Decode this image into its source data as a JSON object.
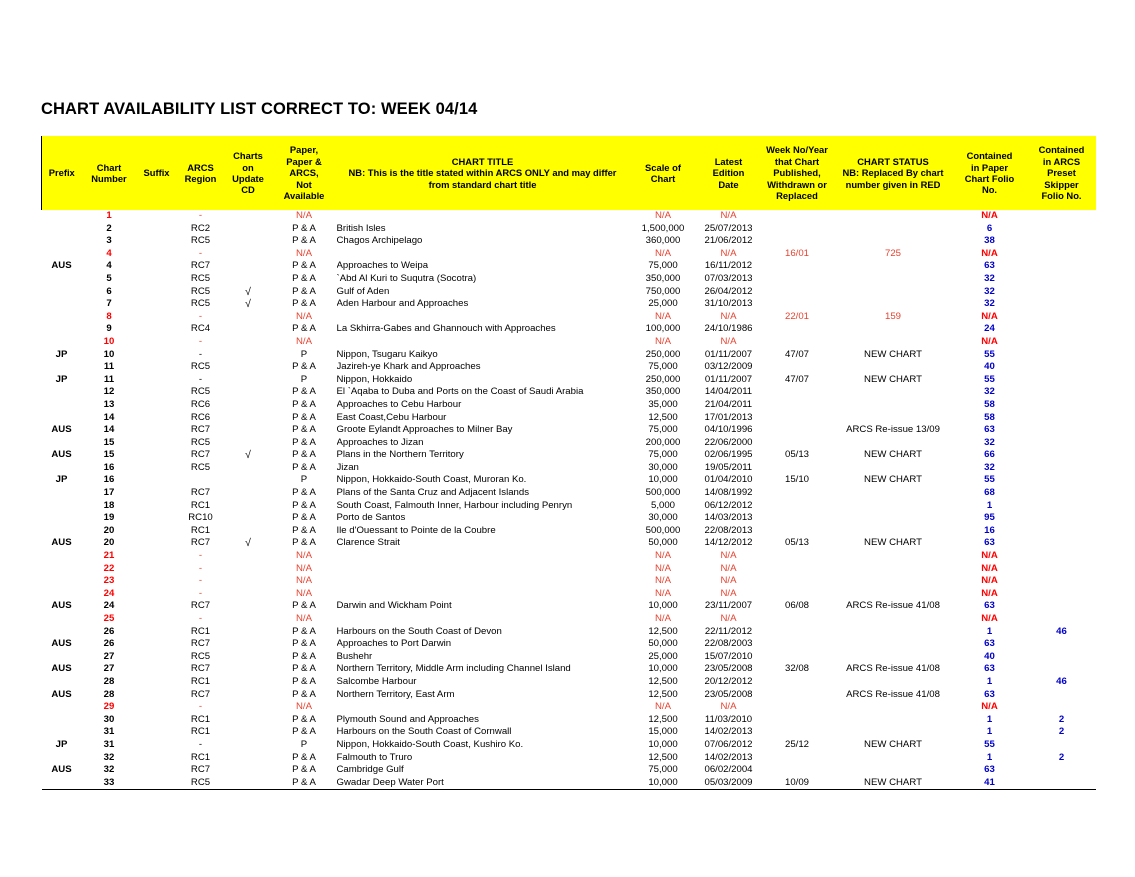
{
  "document": {
    "title": "CHART AVAILABILITY LIST CORRECT TO: WEEK 04/14"
  },
  "colors": {
    "header_background": "#ffff00",
    "folio_blue": "#0000cc",
    "unavailable_red": "#ff0000",
    "border": "#000000"
  },
  "table": {
    "columns": [
      {
        "key": "prefix",
        "label": "Prefix"
      },
      {
        "key": "number",
        "label": "Chart\nNumber"
      },
      {
        "key": "suffix",
        "label": "Suffix"
      },
      {
        "key": "region",
        "label": "ARCS\nRegion"
      },
      {
        "key": "cd",
        "label": "Charts\non\nUpdate\nCD"
      },
      {
        "key": "avail",
        "label": "Paper,\nPaper &\nARCS,\nNot\nAvailable"
      },
      {
        "key": "title",
        "label": "CHART TITLE\nNB: This is the title stated within ARCS ONLY and may differ\nfrom standard chart title"
      },
      {
        "key": "scale",
        "label": "Scale of\nChart"
      },
      {
        "key": "date",
        "label": "Latest\nEdition\nDate"
      },
      {
        "key": "week",
        "label": "Week No/Year\nthat Chart\nPublished,\nWithdrawn or\nReplaced"
      },
      {
        "key": "status",
        "label": "CHART STATUS\nNB: Replaced By chart\nnumber given in RED"
      },
      {
        "key": "folio",
        "label": "Contained\nin Paper\nChart Folio\nNo."
      },
      {
        "key": "skipper",
        "label": "Contained\nin ARCS\nPreset\nSkipper\nFolio No."
      }
    ],
    "header_labels": {
      "prefix": "Prefix",
      "number_l1": "Chart",
      "number_l2": "Number",
      "suffix": "Suffix",
      "region_l1": "ARCS",
      "region_l2": "Region",
      "cd_l1": "Charts",
      "cd_l2": "on",
      "cd_l3": "Update",
      "cd_l4": "CD",
      "avail_l1": "Paper,",
      "avail_l2": "Paper &",
      "avail_l3": "ARCS,",
      "avail_l4": "Not",
      "avail_l5": "Available",
      "title_l1": "CHART TITLE",
      "title_l2": "NB: This is the title stated within ARCS ONLY and may differ",
      "title_l3": "from standard chart title",
      "scale_l1": "Scale of",
      "scale_l2": "Chart",
      "date_l1": "Latest",
      "date_l2": "Edition",
      "date_l3": "Date",
      "week_l1": "Week No/Year",
      "week_l2": "that Chart",
      "week_l3": "Published,",
      "week_l4": "Withdrawn or",
      "week_l5": "Replaced",
      "status_l1": "CHART STATUS",
      "status_l2": "NB: Replaced By chart",
      "status_l3": "number given in RED",
      "folio_l1": "Contained",
      "folio_l2": "in Paper",
      "folio_l3": "Chart Folio",
      "folio_l4": "No.",
      "skipper_l1": "Contained",
      "skipper_l2": "in ARCS",
      "skipper_l3": "Preset",
      "skipper_l4": "Skipper",
      "skipper_l5": "Folio No."
    },
    "rows": [
      {
        "prefix": "",
        "number": "1",
        "suffix": "",
        "region": "-",
        "cd": "",
        "avail": "N/A",
        "title": "",
        "scale": "N/A",
        "date": "N/A",
        "week": "",
        "status": "",
        "folio": "N/A",
        "skipper": "",
        "unavailable": true
      },
      {
        "prefix": "",
        "number": "2",
        "suffix": "",
        "region": "RC2",
        "cd": "",
        "avail": "P & A",
        "title": "British Isles",
        "scale": "1,500,000",
        "date": "25/07/2013",
        "week": "",
        "status": "",
        "folio": "6",
        "skipper": "",
        "unavailable": false
      },
      {
        "prefix": "",
        "number": "3",
        "suffix": "",
        "region": "RC5",
        "cd": "",
        "avail": "P & A",
        "title": "Chagos Archipelago",
        "scale": "360,000",
        "date": "21/06/2012",
        "week": "",
        "status": "",
        "folio": "38",
        "skipper": "",
        "unavailable": false
      },
      {
        "prefix": "",
        "number": "4",
        "suffix": "",
        "region": "-",
        "cd": "",
        "avail": "N/A",
        "title": "",
        "scale": "N/A",
        "date": "N/A",
        "week": "16/01",
        "status": "725",
        "folio": "N/A",
        "skipper": "",
        "unavailable": true
      },
      {
        "prefix": "AUS",
        "number": "4",
        "suffix": "",
        "region": "RC7",
        "cd": "",
        "avail": "P & A",
        "title": "Approaches to Weipa",
        "scale": "75,000",
        "date": "16/11/2012",
        "week": "",
        "status": "",
        "folio": "63",
        "skipper": "",
        "unavailable": false
      },
      {
        "prefix": "",
        "number": "5",
        "suffix": "",
        "region": "RC5",
        "cd": "",
        "avail": "P & A",
        "title": "`Abd Al Kuri to Suqutra (Socotra)",
        "scale": "350,000",
        "date": "07/03/2013",
        "week": "",
        "status": "",
        "folio": "32",
        "skipper": "",
        "unavailable": false
      },
      {
        "prefix": "",
        "number": "6",
        "suffix": "",
        "region": "RC5",
        "cd": "√",
        "avail": "P & A",
        "title": "Gulf of Aden",
        "scale": "750,000",
        "date": "26/04/2012",
        "week": "",
        "status": "",
        "folio": "32",
        "skipper": "",
        "unavailable": false
      },
      {
        "prefix": "",
        "number": "7",
        "suffix": "",
        "region": "RC5",
        "cd": "√",
        "avail": "P & A",
        "title": "Aden Harbour and Approaches",
        "scale": "25,000",
        "date": "31/10/2013",
        "week": "",
        "status": "",
        "folio": "32",
        "skipper": "",
        "unavailable": false
      },
      {
        "prefix": "",
        "number": "8",
        "suffix": "",
        "region": "-",
        "cd": "",
        "avail": "N/A",
        "title": "",
        "scale": "N/A",
        "date": "N/A",
        "week": "22/01",
        "status": "159",
        "folio": "N/A",
        "skipper": "",
        "unavailable": true
      },
      {
        "prefix": "",
        "number": "9",
        "suffix": "",
        "region": "RC4",
        "cd": "",
        "avail": "P & A",
        "title": "La Skhirra-Gabes and Ghannouch with Approaches",
        "scale": "100,000",
        "date": "24/10/1986",
        "week": "",
        "status": "",
        "folio": "24",
        "skipper": "",
        "unavailable": false
      },
      {
        "prefix": "",
        "number": "10",
        "suffix": "",
        "region": "-",
        "cd": "",
        "avail": "N/A",
        "title": "",
        "scale": "N/A",
        "date": "N/A",
        "week": "",
        "status": "",
        "folio": "N/A",
        "skipper": "",
        "unavailable": true
      },
      {
        "prefix": "JP",
        "number": "10",
        "suffix": "",
        "region": "-",
        "cd": "",
        "avail": "P",
        "title": "Nippon, Tsugaru Kaikyo",
        "scale": "250,000",
        "date": "01/11/2007",
        "week": "47/07",
        "status": "NEW CHART",
        "folio": "55",
        "skipper": "",
        "unavailable": false
      },
      {
        "prefix": "",
        "number": "11",
        "suffix": "",
        "region": "RC5",
        "cd": "",
        "avail": "P & A",
        "title": "Jazireh-ye Khark and Approaches",
        "scale": "75,000",
        "date": "03/12/2009",
        "week": "",
        "status": "",
        "folio": "40",
        "skipper": "",
        "unavailable": false
      },
      {
        "prefix": "JP",
        "number": "11",
        "suffix": "",
        "region": "-",
        "cd": "",
        "avail": "P",
        "title": "Nippon, Hokkaido",
        "scale": "250,000",
        "date": "01/11/2007",
        "week": "47/07",
        "status": "NEW CHART",
        "folio": "55",
        "skipper": "",
        "unavailable": false
      },
      {
        "prefix": "",
        "number": "12",
        "suffix": "",
        "region": "RC5",
        "cd": "",
        "avail": "P & A",
        "title": "El `Aqaba to Duba and Ports on the Coast of Saudi Arabia",
        "scale": "350,000",
        "date": "14/04/2011",
        "week": "",
        "status": "",
        "folio": "32",
        "skipper": "",
        "unavailable": false
      },
      {
        "prefix": "",
        "number": "13",
        "suffix": "",
        "region": "RC6",
        "cd": "",
        "avail": "P & A",
        "title": "Approaches to Cebu Harbour",
        "scale": "35,000",
        "date": "21/04/2011",
        "week": "",
        "status": "",
        "folio": "58",
        "skipper": "",
        "unavailable": false
      },
      {
        "prefix": "",
        "number": "14",
        "suffix": "",
        "region": "RC6",
        "cd": "",
        "avail": "P & A",
        "title": "East Coast,Cebu Harbour",
        "scale": "12,500",
        "date": "17/01/2013",
        "week": "",
        "status": "",
        "folio": "58",
        "skipper": "",
        "unavailable": false
      },
      {
        "prefix": "AUS",
        "number": "14",
        "suffix": "",
        "region": "RC7",
        "cd": "",
        "avail": "P & A",
        "title": "Groote Eylandt  Approaches to Milner Bay",
        "scale": "75,000",
        "date": "04/10/1996",
        "week": "",
        "status": "ARCS Re-issue 13/09",
        "folio": "63",
        "skipper": "",
        "unavailable": false
      },
      {
        "prefix": "",
        "number": "15",
        "suffix": "",
        "region": "RC5",
        "cd": "",
        "avail": "P & A",
        "title": "Approaches to Jizan",
        "scale": "200,000",
        "date": "22/06/2000",
        "week": "",
        "status": "",
        "folio": "32",
        "skipper": "",
        "unavailable": false
      },
      {
        "prefix": "AUS",
        "number": "15",
        "suffix": "",
        "region": "RC7",
        "cd": "√",
        "avail": "P & A",
        "title": "Plans in the Northern Territory",
        "scale": "75,000",
        "date": "02/06/1995",
        "week": "05/13",
        "status": "NEW CHART",
        "folio": "66",
        "skipper": "",
        "unavailable": false
      },
      {
        "prefix": "",
        "number": "16",
        "suffix": "",
        "region": "RC5",
        "cd": "",
        "avail": "P & A",
        "title": "Jizan",
        "scale": "30,000",
        "date": "19/05/2011",
        "week": "",
        "status": "",
        "folio": "32",
        "skipper": "",
        "unavailable": false
      },
      {
        "prefix": "JP",
        "number": "16",
        "suffix": "",
        "region": "",
        "cd": "",
        "avail": "P",
        "title": "Nippon, Hokkaido-South Coast, Muroran Ko.",
        "scale": "10,000",
        "date": "01/04/2010",
        "week": "15/10",
        "status": "NEW CHART",
        "folio": "55",
        "skipper": "",
        "unavailable": false
      },
      {
        "prefix": "",
        "number": "17",
        "suffix": "",
        "region": "RC7",
        "cd": "",
        "avail": "P & A",
        "title": "Plans of the Santa Cruz and Adjacent Islands",
        "scale": "500,000",
        "date": "14/08/1992",
        "week": "",
        "status": "",
        "folio": "68",
        "skipper": "",
        "unavailable": false
      },
      {
        "prefix": "",
        "number": "18",
        "suffix": "",
        "region": "RC1",
        "cd": "",
        "avail": "P & A",
        "title": "South Coast, Falmouth Inner, Harbour including Penryn",
        "scale": "5,000",
        "date": "06/12/2012",
        "week": "",
        "status": "",
        "folio": "1",
        "skipper": "",
        "unavailable": false
      },
      {
        "prefix": "",
        "number": "19",
        "suffix": "",
        "region": "RC10",
        "cd": "",
        "avail": "P & A",
        "title": "Porto de Santos",
        "scale": "30,000",
        "date": "14/03/2013",
        "week": "",
        "status": "",
        "folio": "95",
        "skipper": "",
        "unavailable": false
      },
      {
        "prefix": "",
        "number": "20",
        "suffix": "",
        "region": "RC1",
        "cd": "",
        "avail": "P & A",
        "title": "Ile d'Ouessant to Pointe de la Coubre",
        "scale": "500,000",
        "date": "22/08/2013",
        "week": "",
        "status": "",
        "folio": "16",
        "skipper": "",
        "unavailable": false
      },
      {
        "prefix": "AUS",
        "number": "20",
        "suffix": "",
        "region": "RC7",
        "cd": "√",
        "avail": "P & A",
        "title": "Clarence Strait",
        "scale": "50,000",
        "date": "14/12/2012",
        "week": "05/13",
        "status": "NEW CHART",
        "folio": "63",
        "skipper": "",
        "unavailable": false
      },
      {
        "prefix": "",
        "number": "21",
        "suffix": "",
        "region": "-",
        "cd": "",
        "avail": "N/A",
        "title": "",
        "scale": "N/A",
        "date": "N/A",
        "week": "",
        "status": "",
        "folio": "N/A",
        "skipper": "",
        "unavailable": true
      },
      {
        "prefix": "",
        "number": "22",
        "suffix": "",
        "region": "-",
        "cd": "",
        "avail": "N/A",
        "title": "",
        "scale": "N/A",
        "date": "N/A",
        "week": "",
        "status": "",
        "folio": "N/A",
        "skipper": "",
        "unavailable": true
      },
      {
        "prefix": "",
        "number": "23",
        "suffix": "",
        "region": "-",
        "cd": "",
        "avail": "N/A",
        "title": "",
        "scale": "N/A",
        "date": "N/A",
        "week": "",
        "status": "",
        "folio": "N/A",
        "skipper": "",
        "unavailable": true
      },
      {
        "prefix": "",
        "number": "24",
        "suffix": "",
        "region": "-",
        "cd": "",
        "avail": "N/A",
        "title": "",
        "scale": "N/A",
        "date": "N/A",
        "week": "",
        "status": "",
        "folio": "N/A",
        "skipper": "",
        "unavailable": true
      },
      {
        "prefix": "AUS",
        "number": "24",
        "suffix": "",
        "region": "RC7",
        "cd": "",
        "avail": "P & A",
        "title": "Darwin and Wickham Point",
        "scale": "10,000",
        "date": "23/11/2007",
        "week": "06/08",
        "status": "ARCS Re-issue 41/08",
        "folio": "63",
        "skipper": "",
        "unavailable": false
      },
      {
        "prefix": "",
        "number": "25",
        "suffix": "",
        "region": "-",
        "cd": "",
        "avail": "N/A",
        "title": "",
        "scale": "N/A",
        "date": "N/A",
        "week": "",
        "status": "",
        "folio": "N/A",
        "skipper": "",
        "unavailable": true
      },
      {
        "prefix": "",
        "number": "26",
        "suffix": "",
        "region": "RC1",
        "cd": "",
        "avail": "P & A",
        "title": "Harbours on the South Coast of Devon",
        "scale": "12,500",
        "date": "22/11/2012",
        "week": "",
        "status": "",
        "folio": "1",
        "skipper": "46",
        "unavailable": false
      },
      {
        "prefix": "AUS",
        "number": "26",
        "suffix": "",
        "region": "RC7",
        "cd": "",
        "avail": "P & A",
        "title": "Approaches to Port Darwin",
        "scale": "50,000",
        "date": "22/08/2003",
        "week": "",
        "status": "",
        "folio": "63",
        "skipper": "",
        "unavailable": false
      },
      {
        "prefix": "",
        "number": "27",
        "suffix": "",
        "region": "RC5",
        "cd": "",
        "avail": "P & A",
        "title": "Bushehr",
        "scale": "25,000",
        "date": "15/07/2010",
        "week": "",
        "status": "",
        "folio": "40",
        "skipper": "",
        "unavailable": false
      },
      {
        "prefix": "AUS",
        "number": "27",
        "suffix": "",
        "region": "RC7",
        "cd": "",
        "avail": "P & A",
        "title": "Northern Territory, Middle Arm including Channel Island",
        "scale": "10,000",
        "date": "23/05/2008",
        "week": "32/08",
        "status": "ARCS Re-issue 41/08",
        "folio": "63",
        "skipper": "",
        "unavailable": false
      },
      {
        "prefix": "",
        "number": "28",
        "suffix": "",
        "region": "RC1",
        "cd": "",
        "avail": "P & A",
        "title": "Salcombe Harbour",
        "scale": "12,500",
        "date": "20/12/2012",
        "week": "",
        "status": "",
        "folio": "1",
        "skipper": "46",
        "unavailable": false
      },
      {
        "prefix": "AUS",
        "number": "28",
        "suffix": "",
        "region": "RC7",
        "cd": "",
        "avail": "P & A",
        "title": "Northern Territory, East Arm",
        "scale": "12,500",
        "date": "23/05/2008",
        "week": "",
        "status": "ARCS Re-issue 41/08",
        "folio": "63",
        "skipper": "",
        "unavailable": false
      },
      {
        "prefix": "",
        "number": "29",
        "suffix": "",
        "region": "-",
        "cd": "",
        "avail": "N/A",
        "title": "",
        "scale": "N/A",
        "date": "N/A",
        "week": "",
        "status": "",
        "folio": "N/A",
        "skipper": "",
        "unavailable": true
      },
      {
        "prefix": "",
        "number": "30",
        "suffix": "",
        "region": "RC1",
        "cd": "",
        "avail": "P & A",
        "title": "Plymouth Sound and Approaches",
        "scale": "12,500",
        "date": "11/03/2010",
        "week": "",
        "status": "",
        "folio": "1",
        "skipper": "2",
        "unavailable": false
      },
      {
        "prefix": "",
        "number": "31",
        "suffix": "",
        "region": "RC1",
        "cd": "",
        "avail": "P & A",
        "title": "Harbours on the South Coast of Cornwall",
        "scale": "15,000",
        "date": "14/02/2013",
        "week": "",
        "status": "",
        "folio": "1",
        "skipper": "2",
        "unavailable": false
      },
      {
        "prefix": "JP",
        "number": "31",
        "suffix": "",
        "region": "-",
        "cd": "",
        "avail": "P",
        "title": "Nippon, Hokkaido-South Coast, Kushiro Ko.",
        "scale": "10,000",
        "date": "07/06/2012",
        "week": "25/12",
        "status": "NEW CHART",
        "folio": "55",
        "skipper": "",
        "unavailable": false
      },
      {
        "prefix": "",
        "number": "32",
        "suffix": "",
        "region": "RC1",
        "cd": "",
        "avail": "P & A",
        "title": "Falmouth to Truro",
        "scale": "12,500",
        "date": "14/02/2013",
        "week": "",
        "status": "",
        "folio": "1",
        "skipper": "2",
        "unavailable": false
      },
      {
        "prefix": "AUS",
        "number": "32",
        "suffix": "",
        "region": "RC7",
        "cd": "",
        "avail": "P & A",
        "title": "Cambridge Gulf",
        "scale": "75,000",
        "date": "06/02/2004",
        "week": "",
        "status": "",
        "folio": "63",
        "skipper": "",
        "unavailable": false
      },
      {
        "prefix": "",
        "number": "33",
        "suffix": "",
        "region": "RC5",
        "cd": "",
        "avail": "P & A",
        "title": "Gwadar Deep Water Port",
        "scale": "10,000",
        "date": "05/03/2009",
        "week": "10/09",
        "status": "NEW CHART",
        "folio": "41",
        "skipper": "",
        "unavailable": false
      }
    ]
  }
}
